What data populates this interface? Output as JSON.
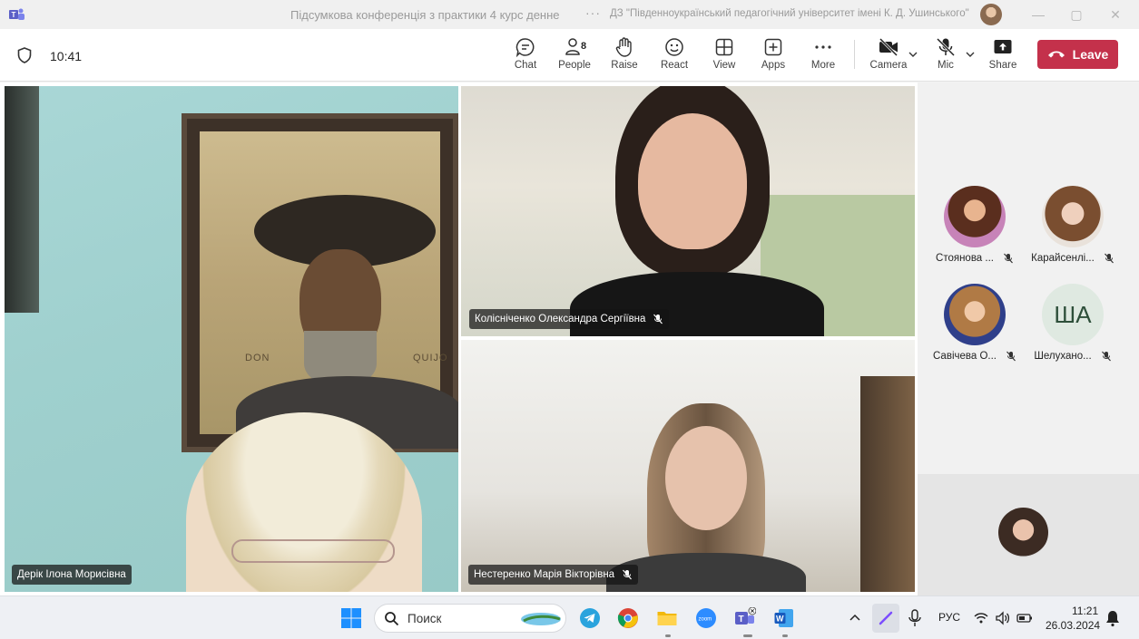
{
  "window": {
    "title": "Підсумкова конференція з практики 4 курс денне",
    "more_dots": "···",
    "org": "ДЗ \"Південноукраїнський педагогічний університет імені К. Д. Ушинського\"",
    "controls": [
      "—",
      "▢",
      "✕"
    ]
  },
  "toolbar": {
    "time": "10:41",
    "buttons": {
      "chat": "Chat",
      "people": "People",
      "people_count": "8",
      "raise": "Raise",
      "react": "React",
      "view": "View",
      "apps": "Apps",
      "more": "More",
      "camera": "Camera",
      "mic": "Mic",
      "share": "Share"
    },
    "leave": "Leave",
    "leave_color": "#c4314b"
  },
  "tiles": [
    {
      "name": "Дерік Ілона Морисівна",
      "muted": false
    },
    {
      "name": "Колісніченко Олександра Сергіївна",
      "muted": true
    },
    {
      "name": "Нестеренко Марія Вікторівна",
      "muted": true
    }
  ],
  "painting_text": {
    "left": "DON",
    "right": "QUIJO"
  },
  "side_participants": [
    {
      "name": "Стоянова ...",
      "muted": true
    },
    {
      "name": "Карайсенлі...",
      "muted": true
    },
    {
      "name": "Савічева О...",
      "muted": true
    },
    {
      "name": "Шелухано...",
      "muted": true,
      "initials": "ША"
    }
  ],
  "taskbar": {
    "search_placeholder": "Поиск",
    "language": "РУС",
    "time": "11:21",
    "date": "26.03.2024",
    "apps": [
      "windows-start",
      "telegram",
      "chrome",
      "file-explorer",
      "zoom",
      "teams",
      "word"
    ]
  }
}
